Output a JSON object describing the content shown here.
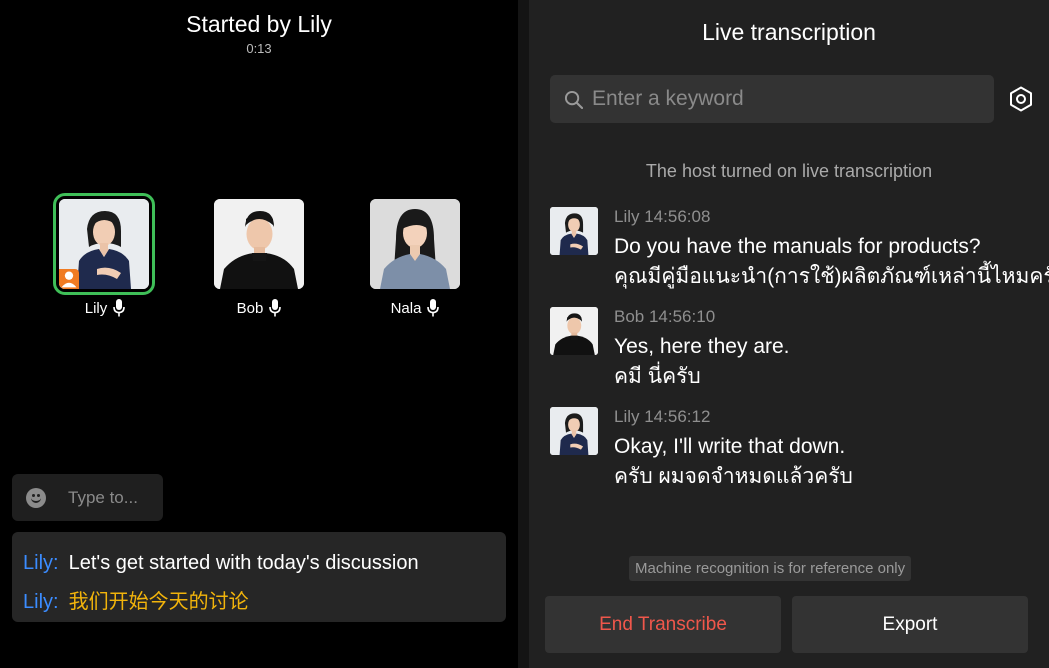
{
  "meeting": {
    "title": "Started by Lily",
    "timer": "0:13"
  },
  "participants": [
    {
      "name": "Lily",
      "is_host": true,
      "active_speaker": true
    },
    {
      "name": "Bob",
      "is_host": false,
      "active_speaker": false
    },
    {
      "name": "Nala",
      "is_host": false,
      "active_speaker": false
    }
  ],
  "chat": {
    "placeholder": "Type to..."
  },
  "live_subtitles": [
    {
      "speaker": "Lily:",
      "text": "Let's get started with today's discussion",
      "lang": "en"
    },
    {
      "speaker": "Lily:",
      "text": "我们开始今天的讨论",
      "lang": "zh"
    }
  ],
  "transcription_panel": {
    "title": "Live transcription",
    "search_placeholder": "Enter a keyword",
    "notice": "The host turned on live transcription",
    "messages": [
      {
        "author": "Lily",
        "meta": "Lily 14:56:08",
        "text": "Do you have the manuals for products?",
        "translation": "คุณมีคู่มือแนะนำ(การใช้)ผลิตภัณฑ์เหล่านี้ไหมครับ",
        "avatar": "lily"
      },
      {
        "author": "Bob",
        "meta": "Bob 14:56:10",
        "text": "Yes, here they are.",
        "translation": "คมี นี่ครับ",
        "avatar": "bob"
      },
      {
        "author": "Lily",
        "meta": "Lily 14:56:12",
        "text": "Okay, I'll write that down.",
        "translation": "ครับ ผมจดจำหมดแล้วครับ",
        "avatar": "lily"
      }
    ],
    "disclaimer": "Machine recognition is for reference only",
    "end_button": "End Transcribe",
    "export_button": "Export"
  },
  "colors": {
    "speaker_name": "#3b8cff",
    "translation_text": "#f2b40b",
    "active_outline": "#3fbf58",
    "host_badge": "#f07b22",
    "end_button_text": "#f0574b"
  },
  "icons": [
    "mic-icon",
    "emoji-icon",
    "search-icon",
    "settings-icon",
    "host-badge-icon"
  ]
}
